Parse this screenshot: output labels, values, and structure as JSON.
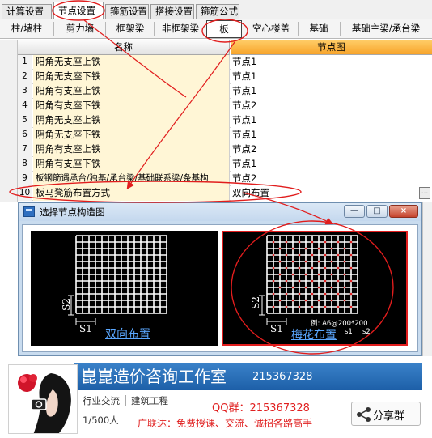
{
  "tabs": [
    "计算设置",
    "节点设置",
    "箍筋设置",
    "搭接设置",
    "箍筋公式"
  ],
  "subtabs": [
    "柱/墙柱",
    "剪力墙",
    "框架梁",
    "非框架梁",
    "板",
    "空心楼盖",
    "基础",
    "基础主梁/承台梁"
  ],
  "table": {
    "headers": {
      "name": "名称",
      "node": "节点图"
    },
    "rows": [
      {
        "num": "1",
        "name": "阳角无支座上铁",
        "node": "节点1"
      },
      {
        "num": "2",
        "name": "阳角无支座下铁",
        "node": "节点1"
      },
      {
        "num": "3",
        "name": "阳角有支座上铁",
        "node": "节点1"
      },
      {
        "num": "4",
        "name": "阳角有支座下铁",
        "node": "节点2"
      },
      {
        "num": "5",
        "name": "阴角无支座上铁",
        "node": "节点1"
      },
      {
        "num": "6",
        "name": "阴角无支座下铁",
        "node": "节点1"
      },
      {
        "num": "7",
        "name": "阴角有支座上铁",
        "node": "节点2"
      },
      {
        "num": "8",
        "name": "阴角有支座下铁",
        "node": "节点1"
      },
      {
        "num": "9",
        "name": "板钢筋遇承台/独基/承台梁/基础联系梁/条基构",
        "node": "节点2"
      },
      {
        "num": "10",
        "name": "板马凳筋布置方式",
        "node": "双向布置"
      }
    ],
    "ellipsis": "..."
  },
  "dialog": {
    "title": "选择节点构造图",
    "minimize": "—",
    "maximize": "□",
    "close": "×",
    "left_caption": "双向布置",
    "right_caption": "梅花布置",
    "s1": "S1",
    "s2": "S2",
    "example": "例: A6@200*200",
    "sub_s1": "s1",
    "sub_s2": "s2"
  },
  "banner": {
    "title": "崑崑造价咨询工作室",
    "qq": "215367328",
    "category1": "行业交流",
    "category2": "建筑工程",
    "members": "1/500人",
    "qq_group": "QQ群：215367328",
    "ad": "广联达：免费授课、交流、诚招各路高手",
    "share_label": "分享群"
  },
  "colors": {
    "header_orange": "#f7a42b",
    "name_cell": "#fff6d6",
    "annotation_red": "#e11d1d",
    "banner_blue": "#1d5fa8",
    "caption_blue": "#5aa7ff"
  }
}
